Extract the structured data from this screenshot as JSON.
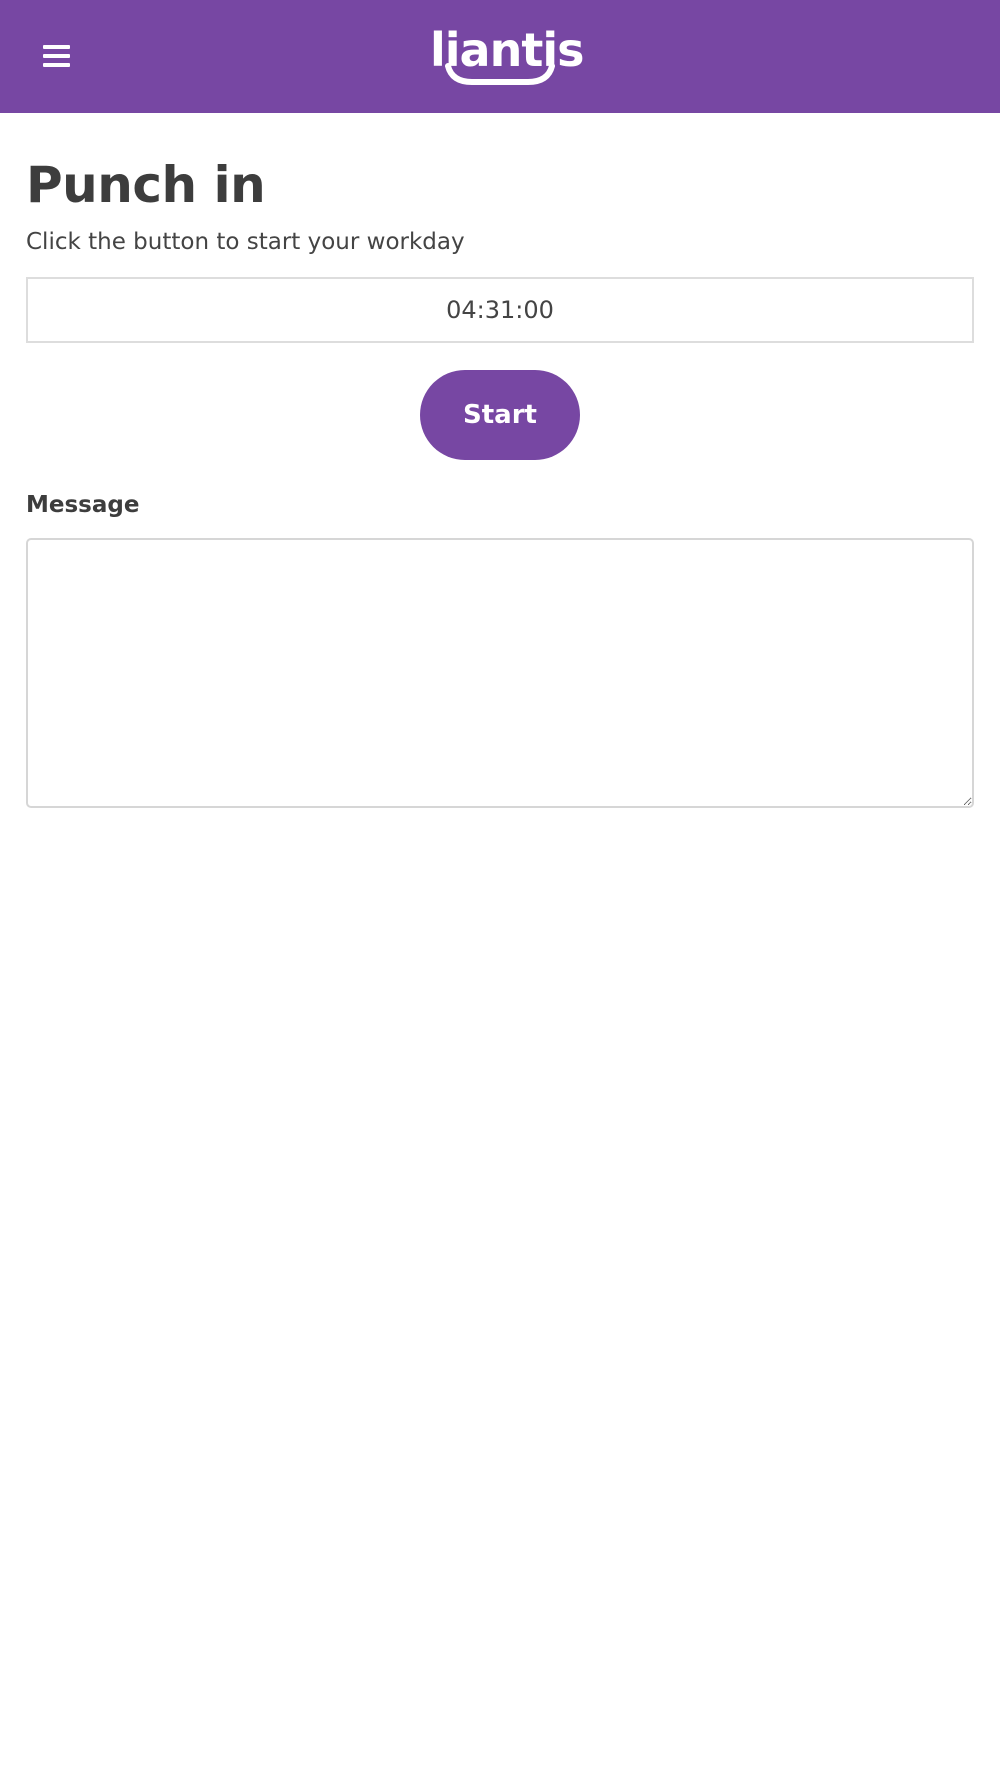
{
  "header": {
    "menu_icon": "hamburger-menu-icon",
    "logo_text": "liantis",
    "background_color": "#7747a3"
  },
  "main": {
    "title": "Punch in",
    "subtitle": "Click the button to start your workday",
    "time_value": "04:31:00",
    "start_label": "Start",
    "message_label": "Message",
    "message_value": "",
    "accent_color": "#7747a3"
  }
}
